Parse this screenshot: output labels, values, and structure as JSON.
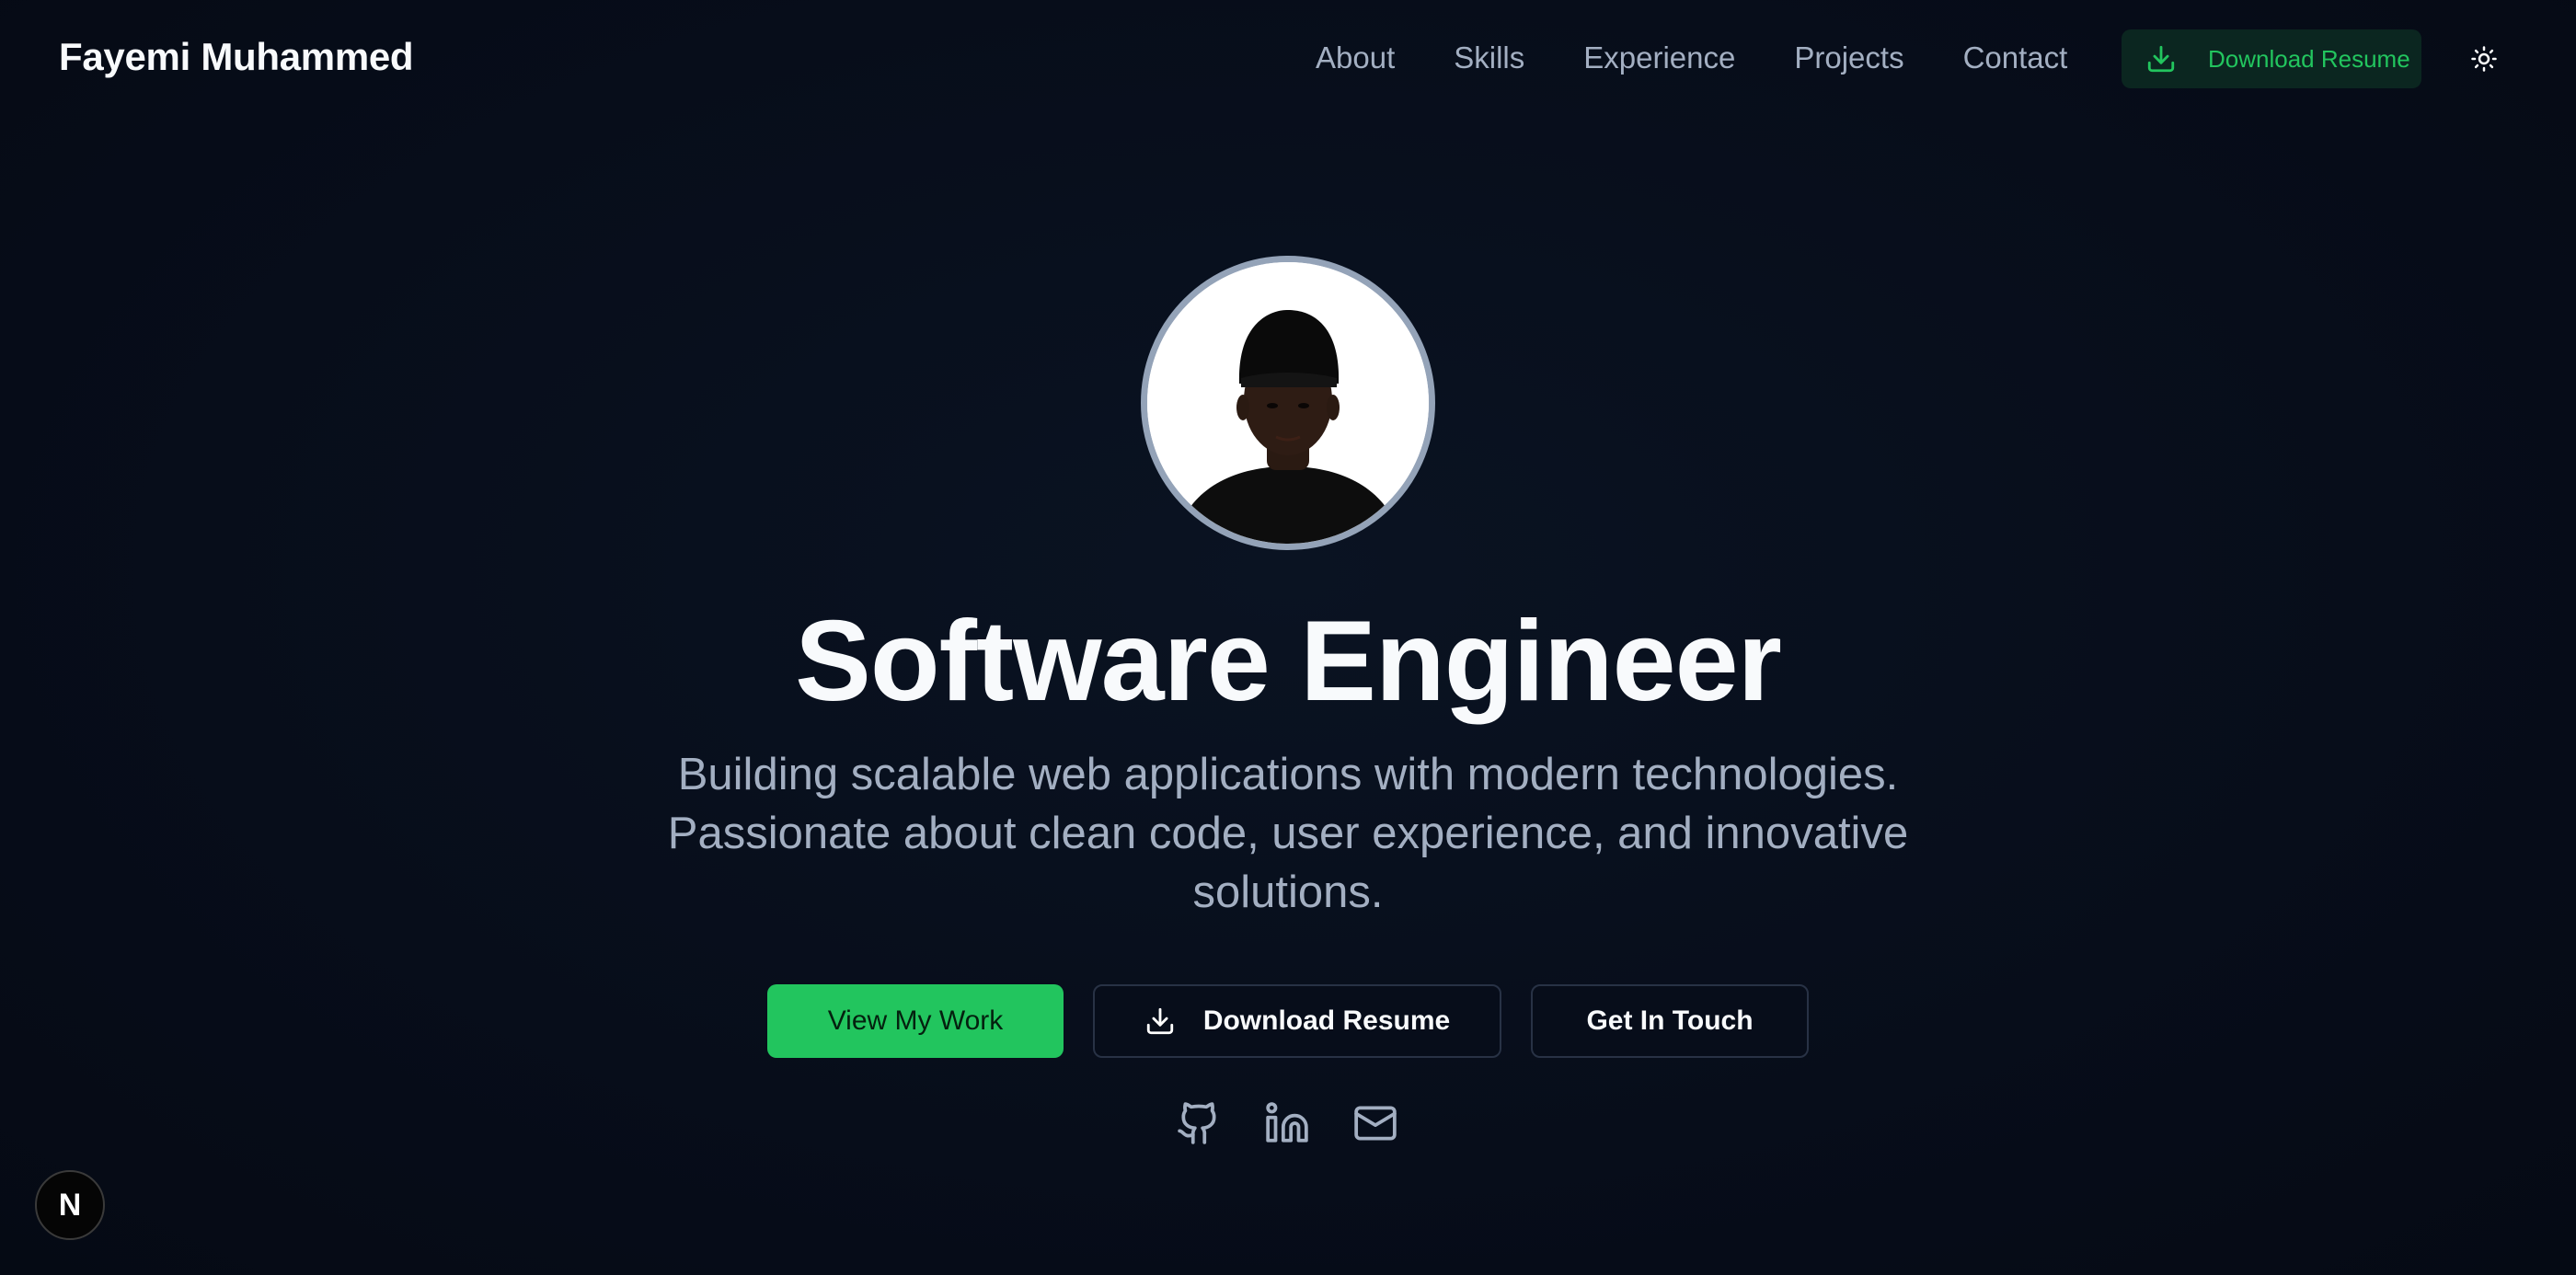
{
  "nav": {
    "brand": "Fayemi Muhammed",
    "links": [
      "About",
      "Skills",
      "Experience",
      "Projects",
      "Contact"
    ],
    "download_label": "Download Resume",
    "download_icon": "download-icon",
    "theme_icon": "sun-icon"
  },
  "hero": {
    "avatar_alt": "profile-photo",
    "title": "Software Engineer",
    "subtitle": "Building scalable web applications with modern technologies. Passionate about clean code, user experience, and innovative solutions.",
    "buttons": {
      "primary": "View My Work",
      "download": "Download Resume",
      "contact": "Get In Touch"
    },
    "socials": [
      "github-icon",
      "linkedin-icon",
      "mail-icon"
    ]
  },
  "badge": {
    "label": "N"
  },
  "colors": {
    "background": "#070d1a",
    "accent": "#22c55e",
    "muted_text": "#a3afc2",
    "heading": "#f8fafc"
  }
}
